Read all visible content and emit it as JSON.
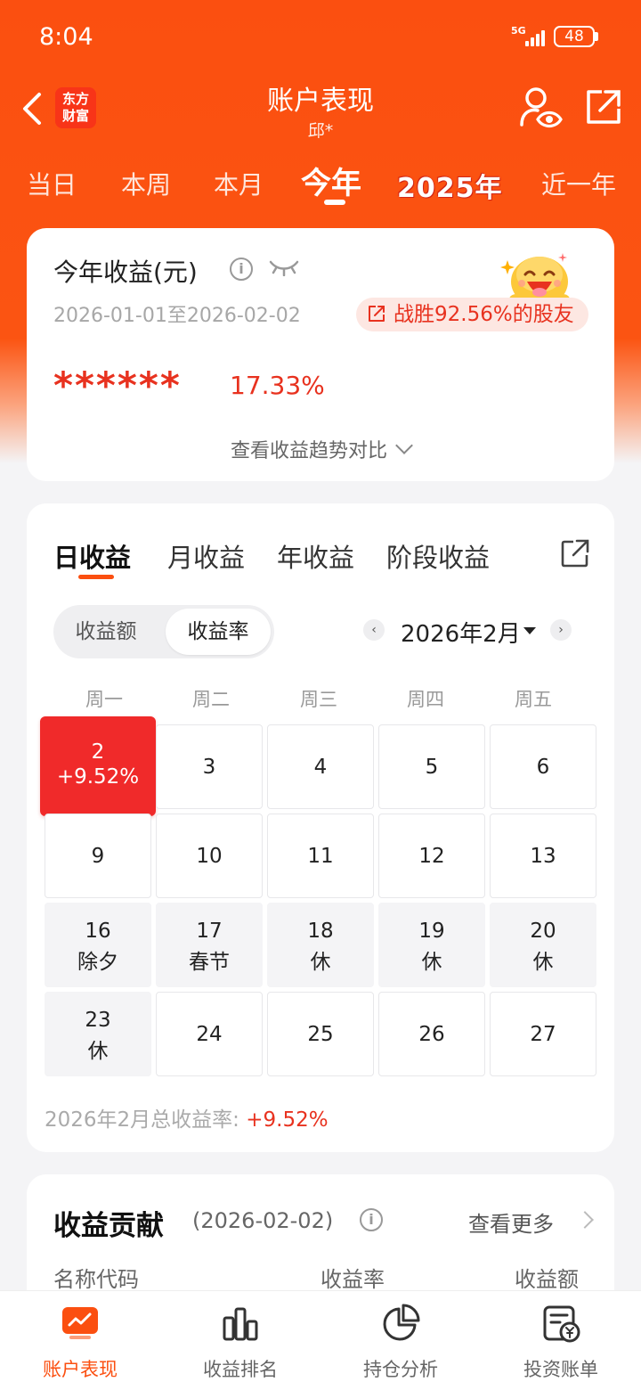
{
  "status_bar": {
    "time": "8:04",
    "network": "5G",
    "battery": "48"
  },
  "header": {
    "title": "账户表现",
    "subtitle": "邱*",
    "logo_text_1": "东方",
    "logo_text_2": "财富"
  },
  "period_tabs": [
    {
      "label": "当日",
      "active": false
    },
    {
      "label": "本周",
      "active": false
    },
    {
      "label": "本月",
      "active": false
    },
    {
      "label": "今年",
      "active": true
    },
    {
      "label": "2025年",
      "active": false
    },
    {
      "label": "近一年",
      "active": false
    }
  ],
  "summary": {
    "title": "今年收益(元)",
    "date_range": "2026-01-01至2026-02-02",
    "beat_text": "战胜92.56%的股友",
    "masked_amount": "******",
    "return_rate": "17.33%",
    "trend_link": "查看收益趋势对比"
  },
  "calendar_card": {
    "tabs": [
      {
        "label": "日收益",
        "active": true
      },
      {
        "label": "月收益",
        "active": false
      },
      {
        "label": "年收益",
        "active": false
      },
      {
        "label": "阶段收益",
        "active": false
      }
    ],
    "segment": {
      "options": [
        "收益额",
        "收益率"
      ],
      "selected": "收益率"
    },
    "month": "2026年2月",
    "weekdays": [
      "周一",
      "周二",
      "周三",
      "周四",
      "周五"
    ],
    "weeks": [
      [
        {
          "day": "2",
          "note": "+9.52%",
          "highlight": true
        },
        {
          "day": "3"
        },
        {
          "day": "4"
        },
        {
          "day": "5"
        },
        {
          "day": "6"
        }
      ],
      [
        {
          "day": "9"
        },
        {
          "day": "10"
        },
        {
          "day": "11"
        },
        {
          "day": "12"
        },
        {
          "day": "13"
        }
      ],
      [
        {
          "day": "16",
          "note": "除夕",
          "closed": true
        },
        {
          "day": "17",
          "note": "春节",
          "closed": true
        },
        {
          "day": "18",
          "note": "休",
          "closed": true
        },
        {
          "day": "19",
          "note": "休",
          "closed": true
        },
        {
          "day": "20",
          "note": "休",
          "closed": true
        }
      ],
      [
        {
          "day": "23",
          "note": "休",
          "closed": true
        },
        {
          "day": "24"
        },
        {
          "day": "25"
        },
        {
          "day": "26"
        },
        {
          "day": "27"
        }
      ]
    ],
    "total_label": "2026年2月总收益率:",
    "total_value": "+9.52%"
  },
  "contribution": {
    "title": "收益贡献",
    "date": "(2026-02-02)",
    "more": "查看更多",
    "columns": [
      "名称代码",
      "收益率",
      "收益额"
    ]
  },
  "bottom_nav": [
    {
      "label": "账户表现",
      "icon": "chart-screen-icon",
      "active": true
    },
    {
      "label": "收益排名",
      "icon": "bar-chart-icon",
      "active": false
    },
    {
      "label": "持仓分析",
      "icon": "pie-chart-icon",
      "active": false
    },
    {
      "label": "投资账单",
      "icon": "bill-yen-icon",
      "active": false
    }
  ],
  "colors": {
    "brand": "#fb4f10",
    "gain": "#e8321f",
    "highlight_cell": "#f02a2a"
  }
}
